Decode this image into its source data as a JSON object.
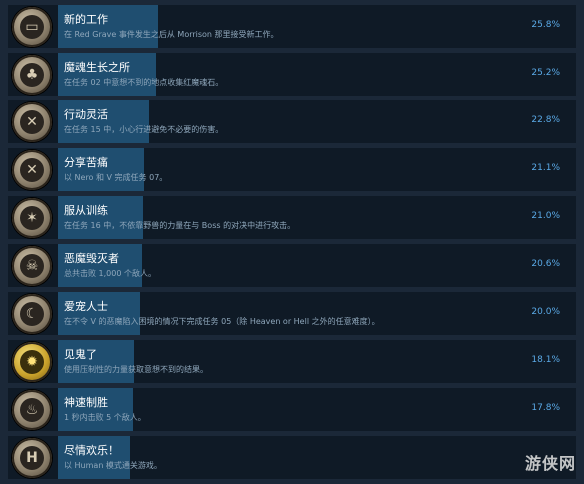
{
  "achievements": [
    {
      "title": "新的工作",
      "desc": "在 Red Grave 事件发生之后从 Morrison 那里接受新工作。",
      "pct": "25.8%",
      "fill": 25.8,
      "icon": "card-icon",
      "glyph": "▭"
    },
    {
      "title": "魔魂生长之所",
      "desc": "在任务 02 中意想不到的地点收集红魔魂石。",
      "pct": "25.2%",
      "fill": 25.2,
      "icon": "tree-icon",
      "glyph": "♣"
    },
    {
      "title": "行动灵活",
      "desc": "在任务 15 中，小心行进避免不必要的伤害。",
      "pct": "22.8%",
      "fill": 22.8,
      "icon": "crossed-blades-icon",
      "glyph": "✕"
    },
    {
      "title": "分享苦痛",
      "desc": "以 Nero 和 V 完成任务 07。",
      "pct": "21.1%",
      "fill": 21.1,
      "icon": "crossed-swords-icon",
      "glyph": "✕"
    },
    {
      "title": "服从训练",
      "desc": "在任务 16 中，不依靠野兽的力量在与 Boss 的对决中进行攻击。",
      "pct": "21.0%",
      "fill": 21.0,
      "icon": "beast-icon",
      "glyph": "✶"
    },
    {
      "title": "恶魔毁灭者",
      "desc": "总共击败 1,000 个敌人。",
      "pct": "20.6%",
      "fill": 20.6,
      "icon": "demon-skull-icon",
      "glyph": "☠"
    },
    {
      "title": "爱宠人士",
      "desc": "在不令 V 的恶魔陷入困境的情况下完成任务 05（除 Heaven or Hell 之外的任意难度）。",
      "pct": "20.0%",
      "fill": 20.0,
      "icon": "crescent-icon",
      "glyph": "☾"
    },
    {
      "title": "见鬼了",
      "desc": "使用压制性的力量获取意想不到的结果。",
      "pct": "18.1%",
      "fill": 18.1,
      "icon": "burst-icon",
      "glyph": "✹",
      "gold": true
    },
    {
      "title": "神速制胜",
      "desc": "1 秒内击败 5 个敌人。",
      "pct": "17.8%",
      "fill": 17.8,
      "icon": "flame-icon",
      "glyph": "♨"
    },
    {
      "title": "尽情欢乐！",
      "desc": "以 Human 模式通关游戏。",
      "pct": "",
      "fill": 16.6,
      "icon": "letter-h-icon",
      "glyph": "H"
    }
  ],
  "watermark": "游侠网"
}
